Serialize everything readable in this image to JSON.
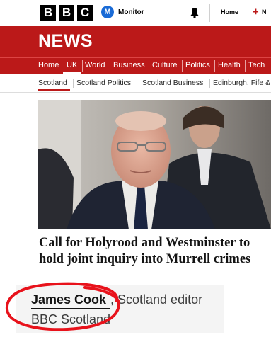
{
  "header": {
    "logo_letters": [
      "B",
      "B",
      "C"
    ],
    "monitor_badge": "M",
    "monitor_label": "Monitor",
    "home_label": "Home",
    "news_label": "N"
  },
  "news_band": {
    "title": "NEWS"
  },
  "nav": {
    "items": [
      {
        "label": "Home"
      },
      {
        "label": "UK",
        "active": true
      },
      {
        "label": "World"
      },
      {
        "label": "Business"
      },
      {
        "label": "Culture"
      },
      {
        "label": "Politics"
      },
      {
        "label": "Health"
      },
      {
        "label": "Tech"
      }
    ]
  },
  "subnav": {
    "items": [
      {
        "label": "Scotland",
        "active": true
      },
      {
        "label": "Scotland Politics"
      },
      {
        "label": "Scotland Business"
      },
      {
        "label": "Edinburgh, Fife &"
      }
    ]
  },
  "article": {
    "headline": "Call for Holyrood and Westminster to hold joint inquiry into Murrell crimes",
    "author_name": "James Cook",
    "author_role": ", Scotland editor",
    "author_org": "BBC Scotland"
  },
  "colors": {
    "brand_red": "#bb1919",
    "annotation_red": "#e8121b"
  },
  "icons": [
    "bbc-logo",
    "monitor-icon",
    "bell-icon",
    "news-icon"
  ]
}
